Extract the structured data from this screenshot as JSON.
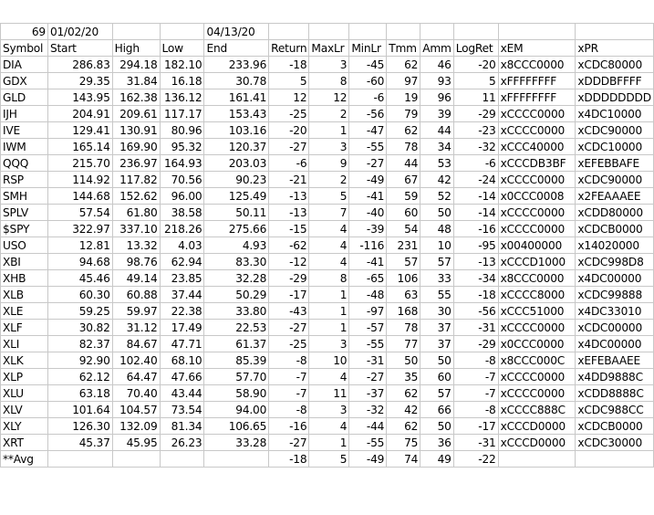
{
  "top_row": [
    "69",
    "01/02/20",
    "",
    "",
    "04/13/20",
    "",
    "",
    "",
    "",
    "",
    "",
    "",
    ""
  ],
  "headers": [
    "Symbol",
    "Start",
    "High",
    "Low",
    "End",
    "Return",
    "MaxLr",
    "MinLr",
    "Tmm",
    "Amm",
    "LogRet",
    "xEM",
    "xPR"
  ],
  "rows": [
    [
      "DIA",
      "286.83",
      "294.18",
      "182.10",
      "233.96",
      "-18",
      "3",
      "-45",
      "62",
      "46",
      "-20",
      "x8CCC0000",
      "xCDC80000"
    ],
    [
      "GDX",
      "29.35",
      "31.84",
      "16.18",
      "30.78",
      "5",
      "8",
      "-60",
      "97",
      "93",
      "5",
      "xFFFFFFFF",
      "xDDDBFFFF"
    ],
    [
      "GLD",
      "143.95",
      "162.38",
      "136.12",
      "161.41",
      "12",
      "12",
      "-6",
      "19",
      "96",
      "11",
      "xFFFFFFFF",
      "xDDDDDDDD"
    ],
    [
      "IJH",
      "204.91",
      "209.61",
      "117.17",
      "153.43",
      "-25",
      "2",
      "-56",
      "79",
      "39",
      "-29",
      "xCCCC0000",
      "x4DC10000"
    ],
    [
      "IVE",
      "129.41",
      "130.91",
      "80.96",
      "103.16",
      "-20",
      "1",
      "-47",
      "62",
      "44",
      "-23",
      "xCCCC0000",
      "xCDC90000"
    ],
    [
      "IWM",
      "165.14",
      "169.90",
      "95.32",
      "120.37",
      "-27",
      "3",
      "-55",
      "78",
      "34",
      "-32",
      "xCCC40000",
      "xCDC10000"
    ],
    [
      "QQQ",
      "215.70",
      "236.97",
      "164.93",
      "203.03",
      "-6",
      "9",
      "-27",
      "44",
      "53",
      "-6",
      "xCCCDB3BF",
      "xEFEBBAFE"
    ],
    [
      "RSP",
      "114.92",
      "117.82",
      "70.56",
      "90.23",
      "-21",
      "2",
      "-49",
      "67",
      "42",
      "-24",
      "xCCCC0000",
      "xCDC90000"
    ],
    [
      "SMH",
      "144.68",
      "152.62",
      "96.00",
      "125.49",
      "-13",
      "5",
      "-41",
      "59",
      "52",
      "-14",
      "x0CCC0008",
      "x2FEAAAEE"
    ],
    [
      "SPLV",
      "57.54",
      "61.80",
      "38.58",
      "50.11",
      "-13",
      "7",
      "-40",
      "60",
      "50",
      "-14",
      "xCCCC0000",
      "xCDD80000"
    ],
    [
      "$SPY",
      "322.97",
      "337.10",
      "218.26",
      "275.66",
      "-15",
      "4",
      "-39",
      "54",
      "48",
      "-16",
      "xCCCC0000",
      "xCDCB0000"
    ],
    [
      "USO",
      "12.81",
      "13.32",
      "4.03",
      "4.93",
      "-62",
      "4",
      "-116",
      "231",
      "10",
      "-95",
      "x00400000",
      "x14020000"
    ],
    [
      "XBI",
      "94.68",
      "98.76",
      "62.94",
      "83.30",
      "-12",
      "4",
      "-41",
      "57",
      "57",
      "-13",
      "xCCCD1000",
      "xCDC998D8"
    ],
    [
      "XHB",
      "45.46",
      "49.14",
      "23.85",
      "32.28",
      "-29",
      "8",
      "-65",
      "106",
      "33",
      "-34",
      "x8CCC0000",
      "x4DC00000"
    ],
    [
      "XLB",
      "60.30",
      "60.88",
      "37.44",
      "50.29",
      "-17",
      "1",
      "-48",
      "63",
      "55",
      "-18",
      "xCCCC8000",
      "xCDC99888"
    ],
    [
      "XLE",
      "59.25",
      "59.97",
      "22.38",
      "33.80",
      "-43",
      "1",
      "-97",
      "168",
      "30",
      "-56",
      "xCCC51000",
      "x4DC33010"
    ],
    [
      "XLF",
      "30.82",
      "31.12",
      "17.49",
      "22.53",
      "-27",
      "1",
      "-57",
      "78",
      "37",
      "-31",
      "xCCCC0000",
      "xCDC00000"
    ],
    [
      "XLI",
      "82.37",
      "84.67",
      "47.71",
      "61.37",
      "-25",
      "3",
      "-55",
      "77",
      "37",
      "-29",
      "x0CCC0000",
      "x4DC00000"
    ],
    [
      "XLK",
      "92.90",
      "102.40",
      "68.10",
      "85.39",
      "-8",
      "10",
      "-31",
      "50",
      "50",
      "-8",
      "x8CCC000C",
      "xEFEBAAEE"
    ],
    [
      "XLP",
      "62.12",
      "64.47",
      "47.66",
      "57.70",
      "-7",
      "4",
      "-27",
      "35",
      "60",
      "-7",
      "xCCCC0000",
      "x4DD9888C"
    ],
    [
      "XLU",
      "63.18",
      "70.40",
      "43.44",
      "58.90",
      "-7",
      "11",
      "-37",
      "62",
      "57",
      "-7",
      "xCCCC0000",
      "xCDD8888C"
    ],
    [
      "XLV",
      "101.64",
      "104.57",
      "73.54",
      "94.00",
      "-8",
      "3",
      "-32",
      "42",
      "66",
      "-8",
      "xCCCC888C",
      "xCDC988CC"
    ],
    [
      "XLY",
      "126.30",
      "132.09",
      "81.34",
      "106.65",
      "-16",
      "4",
      "-44",
      "62",
      "50",
      "-17",
      "xCCCD0000",
      "xCDCB0000"
    ],
    [
      "XRT",
      "45.37",
      "45.95",
      "26.23",
      "33.28",
      "-27",
      "1",
      "-55",
      "75",
      "36",
      "-31",
      "xCCCD0000",
      "xCDC30000"
    ]
  ],
  "avg_row": [
    "**Avg",
    "",
    "",
    "",
    "",
    "-18",
    "5",
    "-49",
    "74",
    "49",
    "-22",
    "",
    ""
  ],
  "colors": {
    "grid": "#c8c8c8",
    "text": "#000000",
    "background": "#ffffff"
  }
}
